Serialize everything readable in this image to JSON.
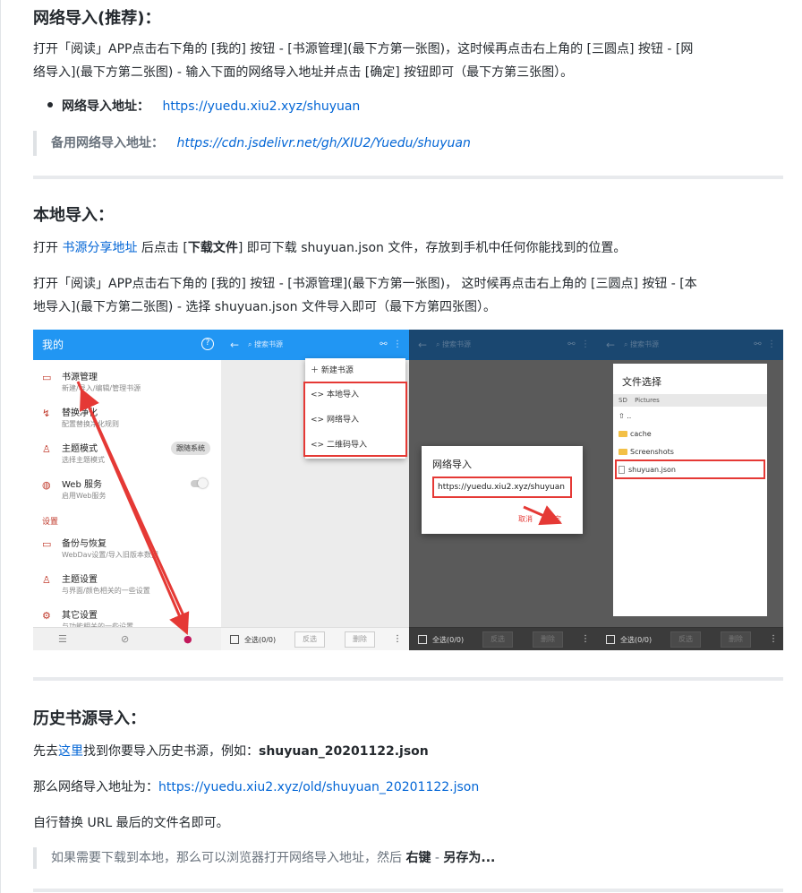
{
  "section1": {
    "title": "网络导入(推荐)：",
    "p1": [
      "打开「阅读」APP点击右下角的 ",
      "[我的] 按钮",
      " - [",
      "书源管理",
      "](最下方第一张图)，这时候再点击右上角的 [",
      "三圆点",
      "] ",
      "按钮",
      " - [",
      "网络导入",
      "](最下方第二张图) - 输入下面的网络导入地址并点击 [",
      "确定",
      "] 按钮即可（最下方第三张图）。"
    ],
    "p1_line1": "打开「阅读」APP点击右下角的 [我的] 按钮 - [书源管理](最下方第一张图)，这时候再点击右上角的 [三圆点] 按钮 - [网",
    "p1_line2": "络导入](最下方第二张图) - 输入下面的网络导入地址并点击 [确定] 按钮即可（最下方第三张图）。",
    "bullet_label": "网络导入地址：",
    "bullet_url": "https://yuedu.xiu2.xyz/shuyuan",
    "backup_label": "备用网络导入地址：",
    "backup_url": "https://cdn.jsdelivr.net/gh/XIU2/Yuedu/shuyuan"
  },
  "section2": {
    "title": "本地导入：",
    "p1_pre": "打开 ",
    "p1_link": "书源分享地址",
    "p1_mid": " 后点击 [",
    "p1_bold": "下载文件",
    "p1_post": "] 即可下载 shuyuan.json 文件，存放到手机中任何你能找到的位置。",
    "p2_line1": "打开「阅读」APP点击右下角的 [我的] 按钮 - [书源管理](最下方第一张图)， 这时候再点击右上角的 [三圆点] 按钮 - [本",
    "p2_line2": "地导入](最下方第二张图) - 选择 shuyuan.json 文件导入即可（最下方第四张图）。"
  },
  "shot": {
    "p1": {
      "title": "我的",
      "help_icon": "?",
      "items": [
        {
          "title": "书源管理",
          "sub": "新建/导入/编辑/管理书源",
          "icon": "book-icon"
        },
        {
          "title": "替换净化",
          "sub": "配置替换净化规则",
          "icon": "replace-icon"
        },
        {
          "title": "主题模式",
          "sub": "选择主题模式",
          "icon": "shirt-icon"
        },
        {
          "title": "Web 服务",
          "sub": "启用Web服务",
          "icon": "globe-icon"
        },
        {
          "title": "备份与恢复",
          "sub": "WebDav设置/导入旧版本数据",
          "icon": "folder-icon"
        },
        {
          "title": "主题设置",
          "sub": "与界面/颜色相关的一些设置",
          "icon": "shirt-icon"
        },
        {
          "title": "其它设置",
          "sub": "与功能相关的一些设置",
          "icon": "settings-icon"
        }
      ],
      "chip": "跟随系统",
      "section_label": "设置"
    },
    "p2": {
      "search": "搜索书源",
      "menu": [
        "新建书源",
        "本地导入",
        "网络导入",
        "二维码导入"
      ],
      "select_all": "全选(0/0)",
      "invert": "反选",
      "delete": "删除"
    },
    "p3": {
      "dialog_title": "网络导入",
      "url": "https://yuedu.xiu2.xyz/shuyuan",
      "cancel": "取消",
      "ok": "确定"
    },
    "p4": {
      "title": "文件选择",
      "tabs": [
        "SD",
        "Pictures"
      ],
      "rows": [
        "..",
        "cache",
        "Screenshots",
        "shuyuan.json"
      ]
    }
  },
  "section3": {
    "title": "历史书源导入：",
    "p1_pre": "先去",
    "p1_link": "这里",
    "p1_post": "找到你要导入历史书源，例如：",
    "p1_bold": "shuyuan_20201122.json",
    "p2_pre": "那么网络导入地址为：",
    "p2_link": "https://yuedu.xiu2.xyz/old/shuyuan_20201122.json",
    "p3": "自行替换 URL 最后的文件名即可。",
    "quote_pre": "如果需要下载到本地，那么可以浏览器打开网络导入地址，然后 ",
    "quote_b1": "右键",
    "quote_mid": " - ",
    "quote_b2": "另存为..."
  }
}
